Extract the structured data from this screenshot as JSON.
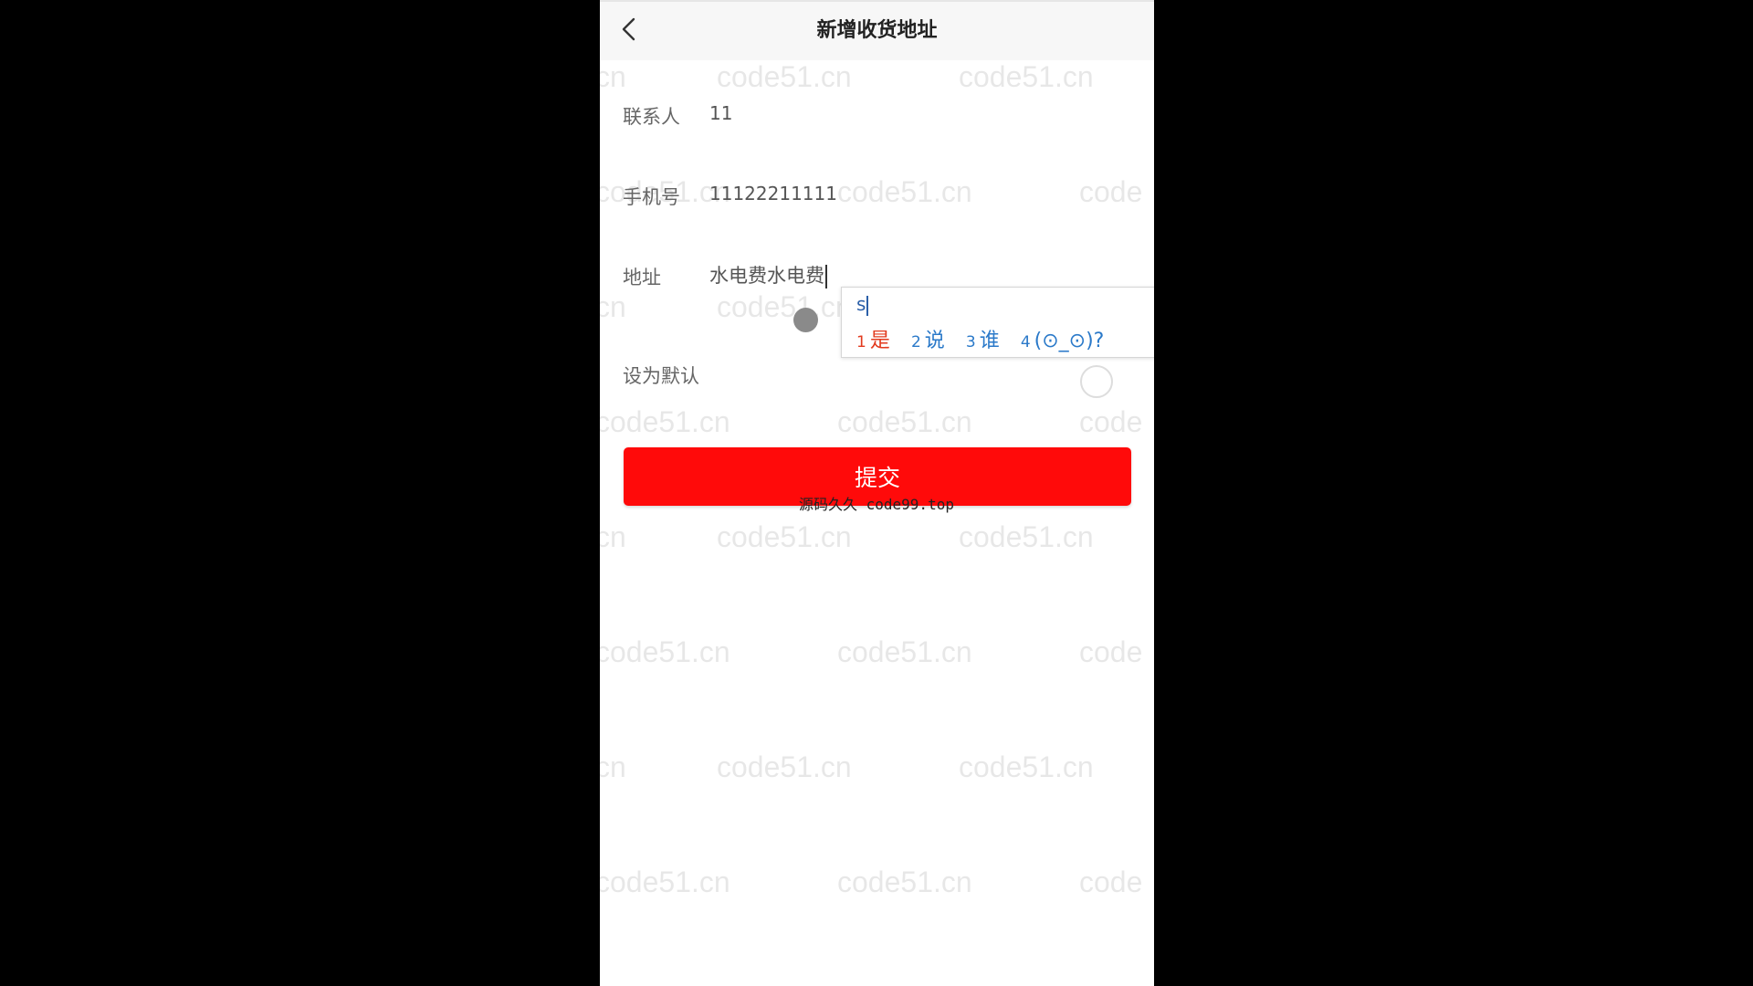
{
  "header": {
    "title": "新增收货地址",
    "back_icon": "chevron-left-icon"
  },
  "form": {
    "contact": {
      "label": "联系人",
      "value": "11"
    },
    "phone": {
      "label": "手机号",
      "value": "11122211111"
    },
    "address": {
      "label": "地址",
      "value": "水电费水电费"
    },
    "default": {
      "label": "设为默认"
    }
  },
  "ime": {
    "composition": "s",
    "candidates": [
      {
        "num": "1",
        "text": "是"
      },
      {
        "num": "2",
        "text": "说"
      },
      {
        "num": "3",
        "text": "谁"
      },
      {
        "num": "4",
        "text": "(⊙_⊙)?"
      }
    ]
  },
  "submit": {
    "label": "提交"
  },
  "overlay_caption": "源码久久 code99.top",
  "watermark": {
    "text": "code51.cn",
    "partial_left": "cn",
    "partial_right": "code"
  },
  "colors": {
    "primary": "#ff0a0a",
    "ime_selected": "#e23a1e",
    "ime_candidate": "#2a79c9"
  }
}
